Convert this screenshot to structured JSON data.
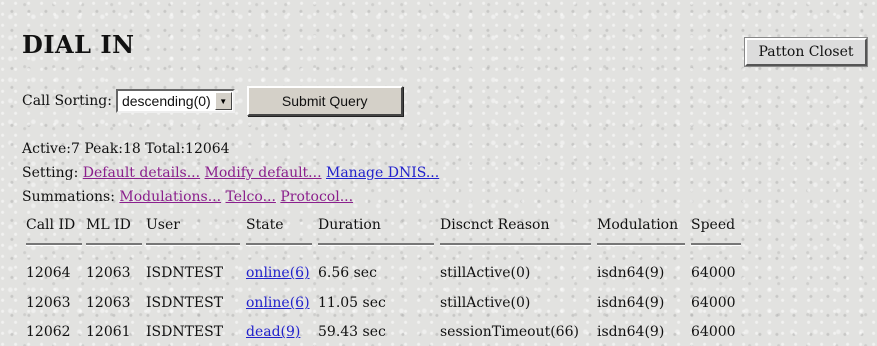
{
  "title": "DIAL IN",
  "corner_button": "Patton Closet",
  "sort": {
    "label": "Call Sorting:",
    "selected": "descending(0)",
    "submit": "Submit Query"
  },
  "stats": "Active:7 Peak:18 Total:12064",
  "setting": {
    "label": "Setting:",
    "links": [
      "Default details...",
      "Modify default...",
      "Manage DNIS..."
    ]
  },
  "summations": {
    "label": "Summations:",
    "links": [
      "Modulations...",
      "Telco...",
      "Protocol..."
    ]
  },
  "columns": [
    "Call ID",
    "ML ID",
    "User",
    "State",
    "Duration",
    "Discnct Reason",
    "Modulation",
    "Speed"
  ],
  "rows": [
    [
      "12064",
      "12063",
      "ISDNTEST",
      "online(6)",
      "6.56 sec",
      "stillActive(0)",
      "isdn64(9)",
      "64000"
    ],
    [
      "12063",
      "12063",
      "ISDNTEST",
      "online(6)",
      "11.05 sec",
      "stillActive(0)",
      "isdn64(9)",
      "64000"
    ],
    [
      "12062",
      "12061",
      "ISDNTEST",
      "dead(9)",
      "59.43 sec",
      "sessionTimeout(66)",
      "isdn64(9)",
      "64000"
    ]
  ]
}
